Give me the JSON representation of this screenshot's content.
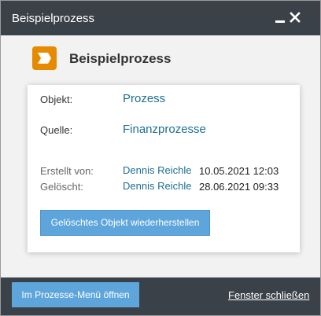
{
  "window": {
    "title": "Beispielprozess",
    "minimize_icon": "minimize-icon",
    "close_icon": "close-icon"
  },
  "header": {
    "icon": "process-chevron-icon",
    "icon_color": "#e68a00",
    "title": "Beispielprozess"
  },
  "details": {
    "object_label": "Objekt:",
    "object_value": "Prozess",
    "source_label": "Quelle:",
    "source_value": "Finanzprozesse",
    "created_label": "Erstellt von:",
    "created_by": "Dennis Reichle",
    "created_date": "10.05.2021 12:03",
    "deleted_label": "Gelöscht:",
    "deleted_by": "Dennis Reichle",
    "deleted_date": "28.06.2021 09:33"
  },
  "actions": {
    "restore_label": "Gelöschtes Objekt wiederherstellen"
  },
  "footer": {
    "open_menu_label": "Im Prozesse-Menü öffnen",
    "close_window_label": "Fenster schließen"
  },
  "colors": {
    "titlebar": "#3b4149",
    "accent_button": "#5ea5dc",
    "link": "#1f6e93"
  }
}
